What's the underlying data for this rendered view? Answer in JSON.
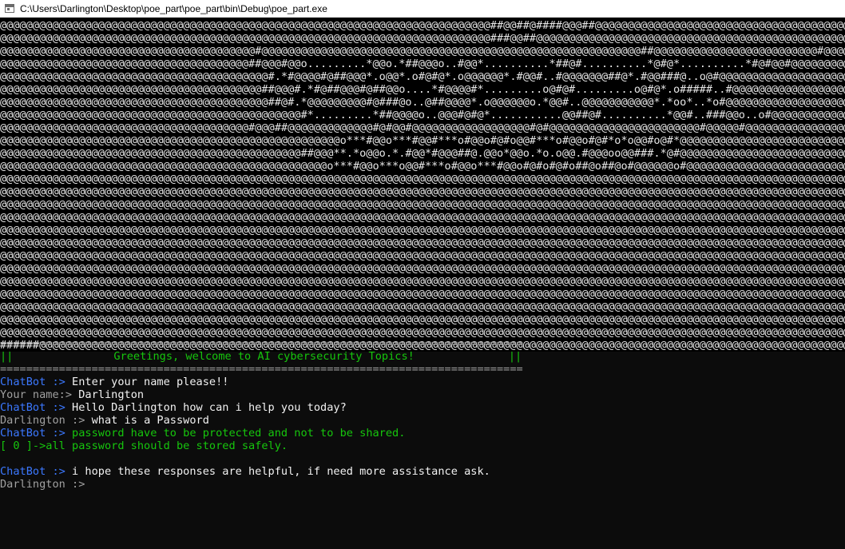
{
  "window": {
    "title": "C:\\Users\\Darlington\\Desktop\\poe_part\\poe_part\\bin\\Debug\\poe_part.exe"
  },
  "console": {
    "ascii_art": [
      "@@@@@@@@@@@@@@@@@@@@@@@@@@@@@@@@@@@@@@@@@@@@@@@@@@@@@@@@@@@@@@@@@@@@@@@@@@@##@@##@####@@@##@@@@@@@@@@@@@@@@@@@@@@@@@@@@@@@@@@@@@@@@@@@@@",
      "@@@@@@@@@@@@@@@@@@@@@@@@@@@@@@@@@@@@@@@@@@@@@@@@@@@@@@@@@@@@@@@@@@@@@@@@@@@###@@##@@@@@@@@@@@@@@@@@@@@@@@@@@@@@@@@@@@@@@@@@@@@@@@@@@@@@@@",
      "@@@@@@@@@@@@@@@@@@@@@@@@@@@@@@@@@@@@@@@#@@@@@@@@@@@@@@@@@@@@@@@@@@@@@@@@@@@@@@@@@@@@@@@@@@@@@@@@@@##@@@@@@@@@@@@@@@@@@@@@@@@@#@@@@@@@@@@@@",
      "@@@@@@@@@@@@@@@@@@@@@@@@@@@@@@@@@@@@@@##@@@#@@o.........*@@o.*##@@@o..#@@*..........*##@#..........*@#@*..........*#@#@@#@@@@@@@@@@@@@@@",
      "@@@@@@@@@@@@@@@@@@@@@@@@@@@@@@@@@@@@@@@@@#.*#@@@@#@##@@@*.o@@*.o#@#@*.o@@@@@@*.#@@#..#@@@@@@@##@*.#@@###@..o@#@@@@@@@@@@@@@@@@@@@@@@@@@",
      "@@@@@@@@@@@@@@@@@@@@@@@@@@@@@@@@@@@@@@@@##@@@#.*#@##@@@#@##@@o....*#@@@@#*.........o@#@#.........o@#@*.o#####..#@@@@@@@@@@@@@@@@@@@@@@@@",
      "@@@@@@@@@@@@@@@@@@@@@@@@@@@@@@@@@@@@@@@@@##@#.*@@@@@@@@@#@###@o..@##@@@@*.o@@@@@@o.*@@#..@@@@@@@@@@@*.*oo*..*o#@@@@@@@@@@@@@@@@@@@@@@@",
      "@@@@@@@@@@@@@@@@@@@@@@@@@@@@@@@@@@@@@@@@@@@@@@#*.........*##@@@@o..@@@#@#@*...........@@##@#..........*@@#..###@@o..o#@@@@@@@@@@@@@@@@@",
      "@@@@@@@@@@@@@@@@@@@@@@@@@@@@@@@@@@@@@@#@@@##@@@@@@@@@@@@@#@#@@#@@@@@@@@@@@@@@@@@@#@#@@@@@@@@@@@@@@@@@@@@@@@#@@@@@#@@@@@@@@@@@@@@@@@@@@@",
      "@@@@@@@@@@@@@@@@@@@@@@@@@@@@@@@@@@@@@@@@@@@@@@@@@@@@o***#@@o***#@@#***o#@@o#@#o@@#***o#@@o#@#*o*o@@#o@#*@@@@@@@@@@@@@@@@@@@@@@@@@@@@@@@",
      "@@@@@@@@@@@@@@@@@@@@@@@@@@@@@@@@@@@@@@@@@@@@@@##@@@**.*o@@o.*.#@@*#@@@##@.@@o*@@o.*o.o@@.#@@@oo@@###.*@#@@@@@@@@@@@@@@@@@@@@@@@@@@@@@",
      "@@@@@@@@@@@@@@@@@@@@@@@@@@@@@@@@@@@@@@@@@@@@@@@@@@o***#@@o***o@@#***o#@@o***#@@o#@#o#@#o##@o##@o#@@@@@@o#@@@@@@@@@@@@@@@@@@@@@@@@@@@@@@",
      "@@@@@@@@@@@@@@@@@@@@@@@@@@@@@@@@@@@@@@@@@@@@@@@@@@@@@@@@@@@@@@@@@@@@@@@@@@@@@@@@@@@@@@@@@@@@@@@@@@@@@@@@@@@@@@@@@@@@@@@@@@@@@@@@@@@@@",
      "@@@@@@@@@@@@@@@@@@@@@@@@@@@@@@@@@@@@@@@@@@@@@@@@@@@@@@@@@@@@@@@@@@@@@@@@@@@@@@@@@@@@@@@@@@@@@@@@@@@@@@@@@@@@@@@@@@@@@@@@@@@@@@@@@@@@@",
      "@@@@@@@@@@@@@@@@@@@@@@@@@@@@@@@@@@@@@@@@@@@@@@@@@@@@@@@@@@@@@@@@@@@@@@@@@@@@@@@@@@@@@@@@@@@@@@@@@@@@@@@@@@@@@@@@@@@@@@@@@@@@@@@@@@@@@",
      "@@@@@@@@@@@@@@@@@@@@@@@@@@@@@@@@@@@@@@@@@@@@@@@@@@@@@@@@@@@@@@@@@@@@@@@@@@@@@@@@@@@@@@@@@@@@@@@@@@@@@@@@@@@@@@@@@@@@@@@@@@@@@@@@@@@@@",
      "@@@@@@@@@@@@@@@@@@@@@@@@@@@@@@@@@@@@@@@@@@@@@@@@@@@@@@@@@@@@@@@@@@@@@@@@@@@@@@@@@@@@@@@@@@@@@@@@@@@@@@@@@@@@@@@@@@@@@@@@@@@@@@@@@@@@@",
      "@@@@@@@@@@@@@@@@@@@@@@@@@@@@@@@@@@@@@@@@@@@@@@@@@@@@@@@@@@@@@@@@@@@@@@@@@@@@@@@@@@@@@@@@@@@@@@@@@@@@@@@@@@@@@@@@@@@@@@@@@@@@@@@@@@@@@",
      "@@@@@@@@@@@@@@@@@@@@@@@@@@@@@@@@@@@@@@@@@@@@@@@@@@@@@@@@@@@@@@@@@@@@@@@@@@@@@@@@@@@@@@@@@@@@@@@@@@@@@@@@@@@@@@@@@@@@@@@@@@@@@@@@@@@@@",
      "@@@@@@@@@@@@@@@@@@@@@@@@@@@@@@@@@@@@@@@@@@@@@@@@@@@@@@@@@@@@@@@@@@@@@@@@@@@@@@@@@@@@@@@@@@@@@@@@@@@@@@@@@@@@@@@@@@@@@@@@@@@@@@@@@@@@@",
      "@@@@@@@@@@@@@@@@@@@@@@@@@@@@@@@@@@@@@@@@@@@@@@@@@@@@@@@@@@@@@@@@@@@@@@@@@@@@@@@@@@@@@@@@@@@@@@@@@@@@@@@@@@@@@@@@@@@@@@@@@@@@@@@@@@@@@",
      "@@@@@@@@@@@@@@@@@@@@@@@@@@@@@@@@@@@@@@@@@@@@@@@@@@@@@@@@@@@@@@@@@@@@@@@@@@@@@@@@@@@@@@@@@@@@@@@@@@@@@@@@@@@@@@@@@@@@@@@@@@@@@@@@@@@@@",
      "@@@@@@@@@@@@@@@@@@@@@@@@@@@@@@@@@@@@@@@@@@@@@@@@@@@@@@@@@@@@@@@@@@@@@@@@@@@@@@@@@@@@@@@@@@@@@@@@@@@@@@@@@@@@@@@@@@@@@@@@@@@@@@@@@@@@@",
      "@@@@@@@@@@@@@@@@@@@@@@@@@@@@@@@@@@@@@@@@@@@@@@@@@@@@@@@@@@@@@@@@@@@@@@@@@@@@@@@@@@@@@@@@@@@@@@@@@@@@@@@@@@@@@@@@@@@@@@@@@@@@@@@@@@@@@",
      "@@@@@@@@@@@@@@@@@@@@@@@@@@@@@@@@@@@@@@@@@@@@@@@@@@@@@@@@@@@@@@@@@@@@@@@@@@@@@@@@@@@@@@@@@@@@@@@@@@@@@@@@@@@@@@@@@@@@@@@@@@@@@@@@@@@@@",
      "######@@@@@@@@@@@@@@@@@@@@@@@@@@@@@@@@@@@@@@@@@@@@@@@@@@@@@@@@@@@@@@@@@@@@@@@@@@@@@@@@@@@@@@@@@@@@@@@@@@@@@@@@@@@@@@@@@@@@@@@@@@@@@@@@@"
    ],
    "separator": "================================================================================",
    "banner": {
      "left": "||",
      "text": "Greetings, welcome to AI cybersecurity Topics!",
      "right": "||"
    },
    "chat": [
      {
        "prefix": "ChatBot :>",
        "text": " Enter your name please!!"
      },
      {
        "prefix": "Your name:>",
        "text": " Darlington"
      },
      {
        "prefix": "ChatBot :>",
        "text": " Hello Darlington how can i help you today?"
      },
      {
        "prefix": "Darlington :>",
        "text": " what is a Password"
      },
      {
        "prefix": "ChatBot :>",
        "text": " password have to be protected and not to be shared."
      },
      {
        "prefix": "",
        "text": "[ 0 ]->all password should be stored safely."
      },
      {
        "prefix": "ChatBot :>",
        "text": " i hope these responses are helpful, if need more assistance ask."
      },
      {
        "prefix": "Darlington :>",
        "text": ""
      }
    ],
    "colors": {
      "user": "#a0a0a0",
      "bot_label": "#3b78ff",
      "bot_text": "#f2f2f2",
      "answer": "#16c60c"
    }
  }
}
